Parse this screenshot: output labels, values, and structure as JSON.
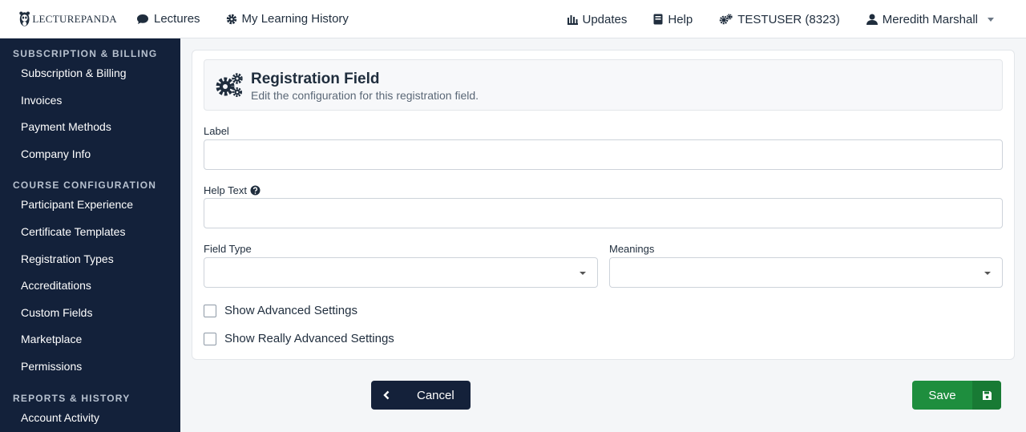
{
  "brand": {
    "name": "LECTUREPANDA"
  },
  "nav": {
    "lectures": "Lectures",
    "history": "My Learning History",
    "updates": "Updates",
    "help": "Help",
    "org": "TESTUSER (8323)",
    "user": "Meredith Marshall"
  },
  "sidebar": {
    "sections": [
      {
        "heading": "Subscription & Billing",
        "items": [
          "Subscription & Billing",
          "Invoices",
          "Payment Methods",
          "Company Info"
        ]
      },
      {
        "heading": "Course Configuration",
        "items": [
          "Participant Experience",
          "Certificate Templates",
          "Registration Types",
          "Accreditations",
          "Custom Fields",
          "Marketplace",
          "Permissions"
        ]
      },
      {
        "heading": "Reports & History",
        "items": [
          "Account Activity"
        ]
      }
    ]
  },
  "form": {
    "title": "Registration Field",
    "subtitle": "Edit the configuration for this registration field.",
    "label_label": "Label",
    "label_value": "",
    "help_label": "Help Text",
    "help_value": "",
    "field_type_label": "Field Type",
    "field_type_value": "",
    "meanings_label": "Meanings",
    "meanings_value": "",
    "advanced": "Show Advanced Settings",
    "really_advanced": "Show Really Advanced Settings"
  },
  "buttons": {
    "cancel": "Cancel",
    "save": "Save"
  },
  "colors": {
    "sidebar_bg": "#13213a",
    "save_green": "#1e8e3e",
    "cancel_dark": "#14213a"
  }
}
